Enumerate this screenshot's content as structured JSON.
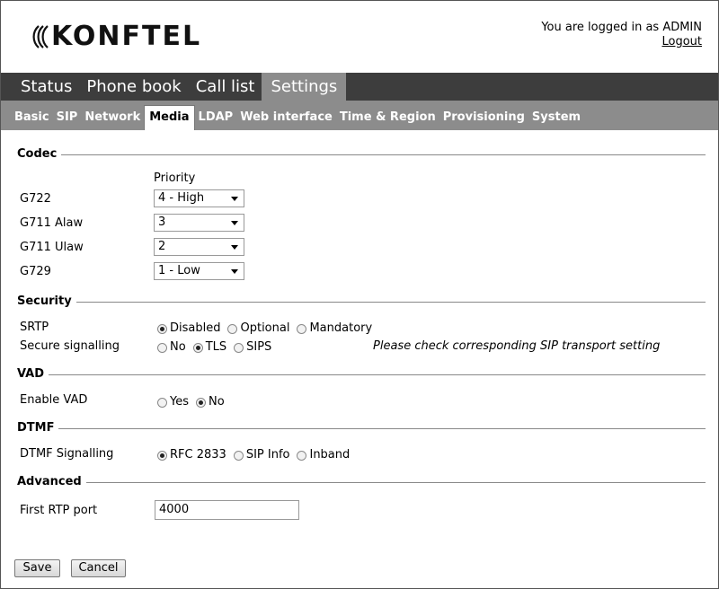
{
  "header": {
    "logo_text": "KONFTEL",
    "logged_in_text": "You are logged in as ADMIN",
    "logout_label": "Logout"
  },
  "main_nav": [
    {
      "label": "Status",
      "active": false
    },
    {
      "label": "Phone book",
      "active": false
    },
    {
      "label": "Call list",
      "active": false
    },
    {
      "label": "Settings",
      "active": true
    }
  ],
  "sub_nav": [
    {
      "label": "Basic",
      "active": false
    },
    {
      "label": "SIP",
      "active": false
    },
    {
      "label": "Network",
      "active": false
    },
    {
      "label": "Media",
      "active": true
    },
    {
      "label": "LDAP",
      "active": false
    },
    {
      "label": "Web interface",
      "active": false
    },
    {
      "label": "Time & Region",
      "active": false
    },
    {
      "label": "Provisioning",
      "active": false
    },
    {
      "label": "System",
      "active": false
    }
  ],
  "codec": {
    "title": "Codec",
    "priority_header": "Priority",
    "rows": [
      {
        "label": "G722",
        "value": "4 - High"
      },
      {
        "label": "G711 Alaw",
        "value": "3"
      },
      {
        "label": "G711 Ulaw",
        "value": "2"
      },
      {
        "label": "G729",
        "value": "1 - Low"
      }
    ]
  },
  "security": {
    "title": "Security",
    "srtp": {
      "label": "SRTP",
      "options": [
        "Disabled",
        "Optional",
        "Mandatory"
      ],
      "selected": "Disabled"
    },
    "secure_signalling": {
      "label": "Secure signalling",
      "options": [
        "No",
        "TLS",
        "SIPS"
      ],
      "selected": "TLS",
      "note": "Please check corresponding SIP transport setting"
    }
  },
  "vad": {
    "title": "VAD",
    "enable": {
      "label": "Enable VAD",
      "options": [
        "Yes",
        "No"
      ],
      "selected": "No"
    }
  },
  "dtmf": {
    "title": "DTMF",
    "signalling": {
      "label": "DTMF Signalling",
      "options": [
        "RFC 2833",
        "SIP Info",
        "Inband"
      ],
      "selected": "RFC 2833"
    }
  },
  "advanced": {
    "title": "Advanced",
    "first_rtp_port": {
      "label": "First RTP port",
      "value": "4000"
    }
  },
  "buttons": {
    "save": "Save",
    "cancel": "Cancel"
  }
}
